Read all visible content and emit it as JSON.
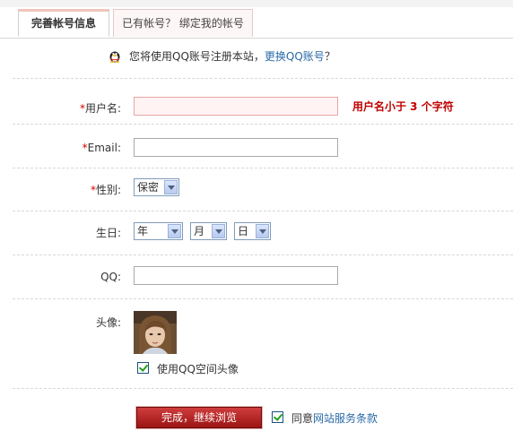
{
  "tabs": [
    {
      "label": "完善帐号信息",
      "active": true
    },
    {
      "label": "已有帐号？ 绑定我的帐号",
      "active": false
    }
  ],
  "info": {
    "text": "您将使用QQ账号注册本站，",
    "link": "更换QQ账号",
    "suffix": "？"
  },
  "form": {
    "required_mark": "*",
    "username": {
      "label": "用户名:",
      "value": "",
      "error": "用户名小于 3 个字符"
    },
    "email": {
      "label": "Email:",
      "value": ""
    },
    "gender": {
      "label": "性别:",
      "selected": "保密"
    },
    "birthday": {
      "label": "生日:",
      "year": "年",
      "month": "月",
      "day": "日"
    },
    "qq": {
      "label": "QQ:",
      "value": ""
    },
    "avatar": {
      "label": "头像:",
      "use_qzone_label": "使用QQ空间头像",
      "checked": true
    }
  },
  "submit": {
    "label": "完成，继续浏览"
  },
  "agree": {
    "prefix": "同意",
    "link": "网站服务条款",
    "checked": true
  },
  "colors": {
    "error": "#c00000",
    "link": "#2a6aa7",
    "button": "#b42222",
    "required": "#d40000"
  }
}
